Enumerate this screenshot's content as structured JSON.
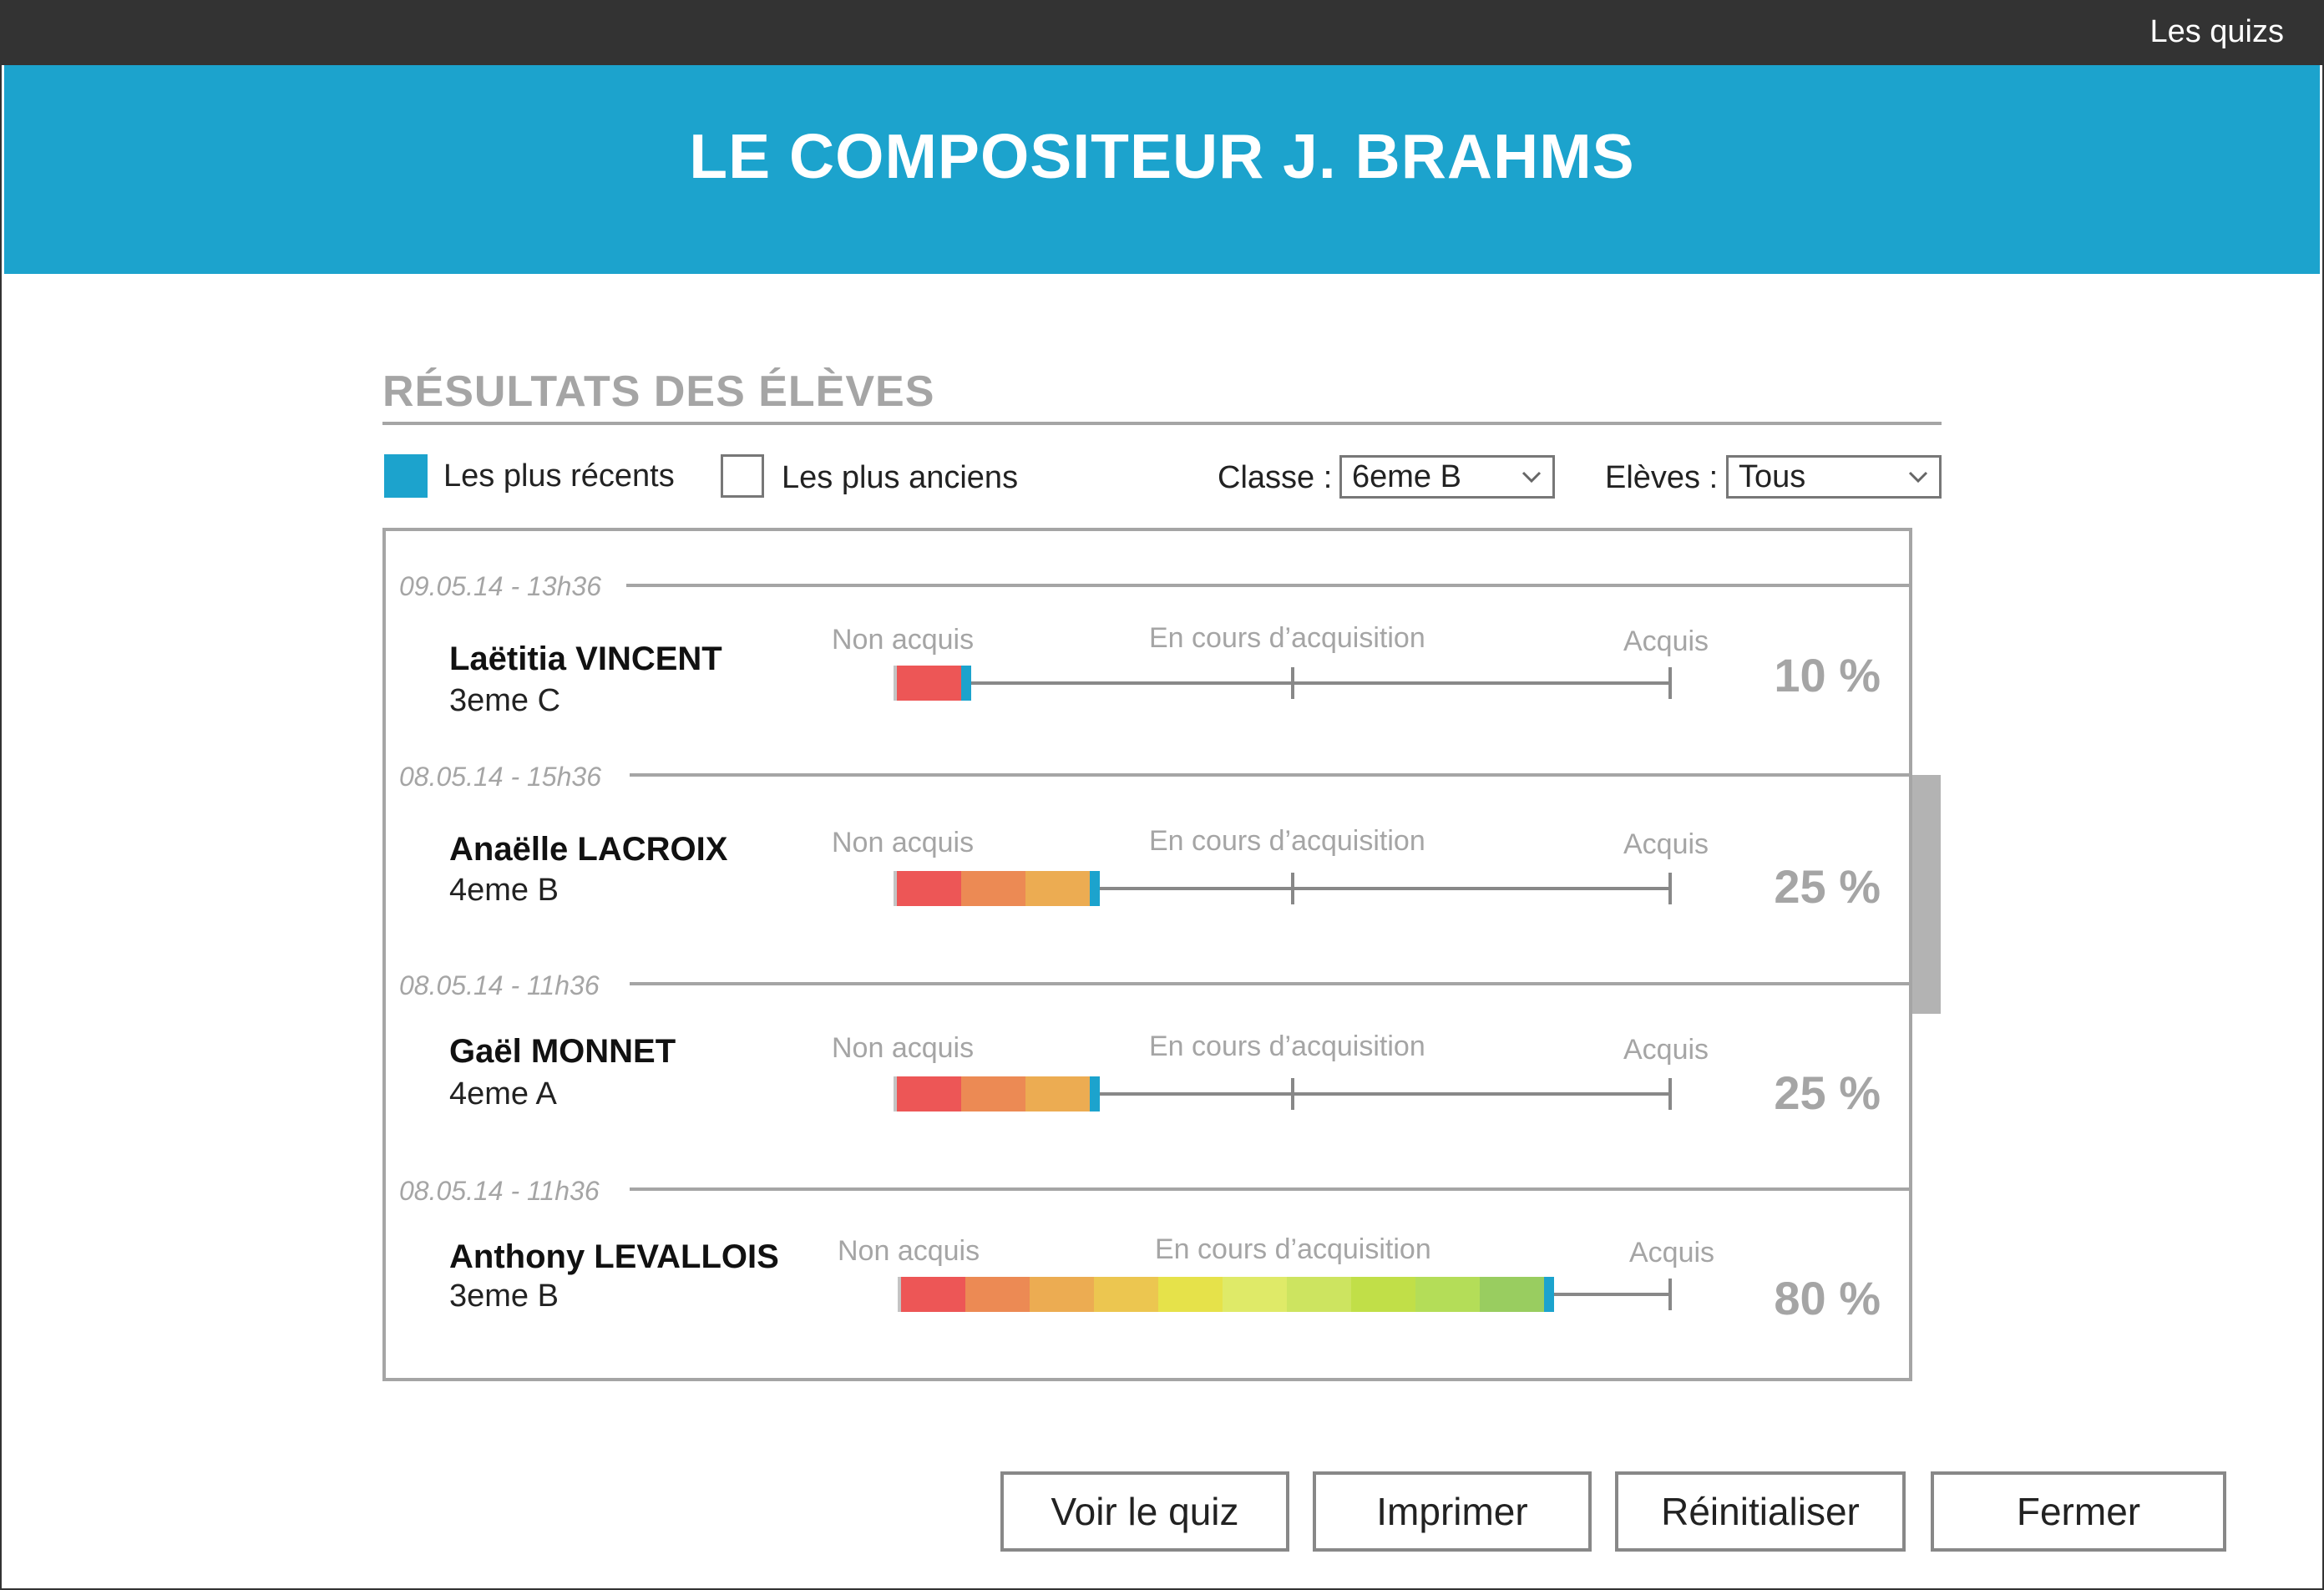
{
  "topbar": {
    "link": "Les quizs"
  },
  "header": {
    "title": "LE COMPOSITEUR J. BRAHMS",
    "color": "#1ca3cd"
  },
  "results": {
    "section_title": "RÉSULTATS DES ÉLÈVES",
    "sort": {
      "recent_label": "Les plus récents",
      "recent_checked": true,
      "oldest_label": "Les plus anciens",
      "oldest_checked": false
    },
    "filters": {
      "class_label": "Classe :",
      "class_value": "6eme B",
      "students_label": "Elèves :",
      "students_value": "Tous"
    },
    "scale": {
      "low": "Non acquis",
      "mid": "En cours d’acquisition",
      "high": "Acquis"
    },
    "palette": [
      "#ed5656",
      "#ec8a54",
      "#ecac52",
      "#ecc650",
      "#e6e24a",
      "#dfea68",
      "#cde460",
      "#c1df48",
      "#b4dd58",
      "#99cd60"
    ],
    "students": [
      {
        "timestamp": "09.05.14 - 13h36",
        "name": "Laëtitia VINCENT",
        "class": "3eme C",
        "score": 10,
        "score_text": "10 %",
        "segments": 1
      },
      {
        "timestamp": "08.05.14 - 15h36",
        "name": "Anaëlle LACROIX",
        "class": "4eme B",
        "score": 25,
        "score_text": "25 %",
        "segments": 3
      },
      {
        "timestamp": "08.05.14 - 11h36",
        "name": "Gaël MONNET",
        "class": "4eme A",
        "score": 25,
        "score_text": "25 %",
        "segments": 3
      },
      {
        "timestamp": "08.05.14 - 11h36",
        "name": "Anthony LEVALLOIS",
        "class": "3eme B",
        "score": 80,
        "score_text": "80 %",
        "segments": 10
      }
    ]
  },
  "buttons": {
    "view": "Voir le quiz",
    "print": "Imprimer",
    "reset": "Réinitialiser",
    "close": "Fermer"
  }
}
